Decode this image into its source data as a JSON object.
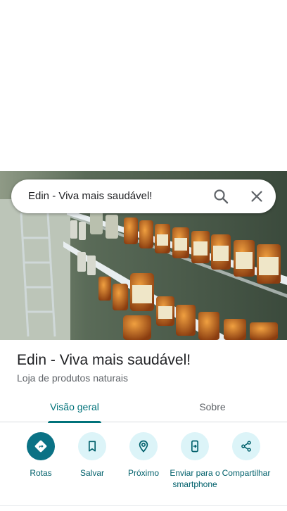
{
  "search": {
    "query": "Edin - Viva mais saudável!"
  },
  "place": {
    "title": "Edin - Viva mais saudável!",
    "category": "Loja de produtos naturais"
  },
  "tabs": [
    {
      "label": "Visão geral",
      "active": true
    },
    {
      "label": "Sobre",
      "active": false
    }
  ],
  "actions": [
    {
      "label": "Rotas",
      "icon": "directions-icon",
      "primary": true
    },
    {
      "label": "Salvar",
      "icon": "bookmark-icon",
      "primary": false
    },
    {
      "label": "Próximo",
      "icon": "nearby-icon",
      "primary": false
    },
    {
      "label": "Enviar para o smartphone",
      "icon": "send-to-phone-icon",
      "primary": false
    },
    {
      "label": "Compartilhar",
      "icon": "share-icon",
      "primary": false
    }
  ],
  "colors": {
    "accent": "#00727a",
    "primary_action": "#0b7285",
    "action_circle": "#dcf4f8"
  }
}
